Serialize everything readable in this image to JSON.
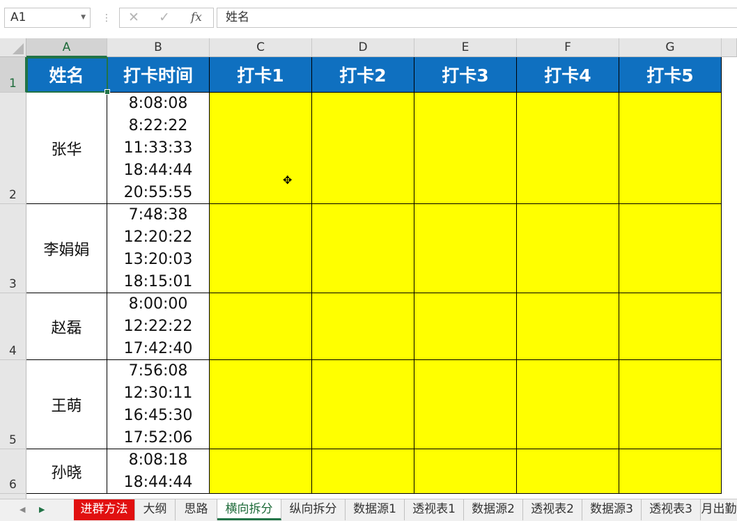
{
  "formula_bar": {
    "name_box": "A1",
    "cancel_icon": "✕",
    "enter_icon": "✓",
    "fx_label": "fx",
    "value": "姓名"
  },
  "columns": [
    "A",
    "B",
    "C",
    "D",
    "E",
    "F",
    "G"
  ],
  "rows": [
    "1",
    "2",
    "3",
    "4",
    "5",
    "6"
  ],
  "headers": [
    "姓名",
    "打卡时间",
    "打卡1",
    "打卡2",
    "打卡3",
    "打卡4",
    "打卡5"
  ],
  "people": [
    {
      "name": "张华",
      "times": [
        "8:08:08",
        "8:22:22",
        "11:33:33",
        "18:44:44",
        "20:55:55"
      ]
    },
    {
      "name": "李娟娟",
      "times": [
        "7:48:38",
        "12:20:22",
        "13:20:03",
        "18:15:01"
      ]
    },
    {
      "name": "赵磊",
      "times": [
        "8:00:00",
        "12:22:22",
        "17:42:40"
      ]
    },
    {
      "name": "王萌",
      "times": [
        "7:56:08",
        "12:30:11",
        "16:45:30",
        "17:52:06"
      ]
    },
    {
      "name": "孙晓",
      "times": [
        "8:08:18",
        "18:44:44"
      ]
    }
  ],
  "sheet_tabs": [
    "进群方法",
    "大纲",
    "思路",
    "横向拆分",
    "纵向拆分",
    "数据源1",
    "透视表1",
    "数据源2",
    "透视表2",
    "数据源3",
    "透视表3",
    "月出勤"
  ],
  "active_tab": "横向拆分",
  "colors": {
    "header_fill": "#0f70c0",
    "output_fill": "#ffff00",
    "highlight_tab": "#e11010",
    "selection": "#217346"
  }
}
